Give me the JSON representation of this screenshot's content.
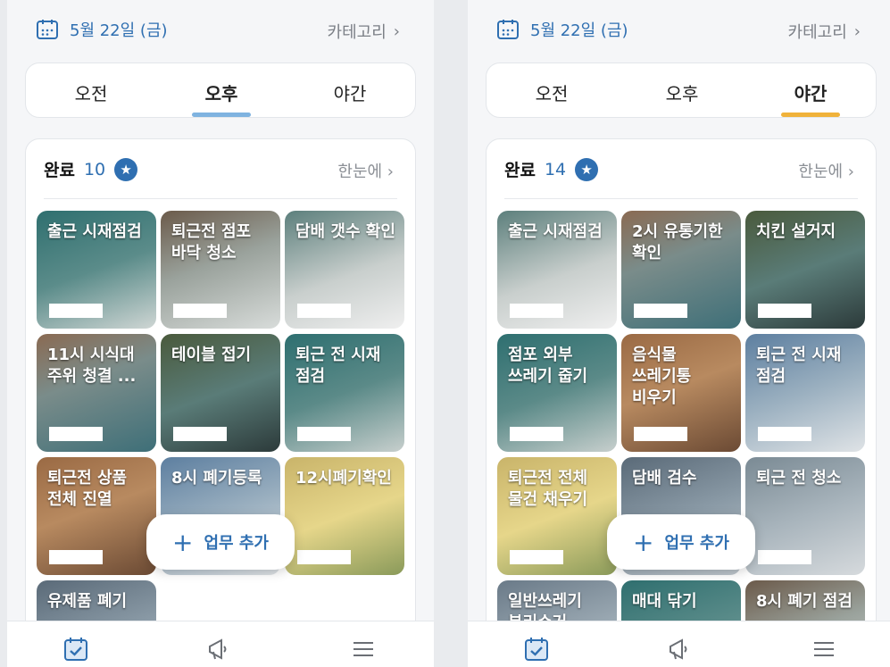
{
  "accent_color": "#2f6fb1",
  "screens": [
    {
      "date": "5월 22일 (금)",
      "category": "카테고리",
      "shifts": [
        "오전",
        "오후",
        "야간"
      ],
      "active_shift": "오후",
      "active_color": "#7fb3e0",
      "done_label": "완료",
      "done_count": "10",
      "glance_label": "한눈에",
      "tasks": [
        "출근 시재점검",
        "퇴근전 점포 바닥 청소",
        "담배 갯수 확인",
        "11시 시식대 주위 청결 ...",
        "테이블 접기",
        "퇴근 전 시재 점검",
        "퇴근전 상품 전체 진열",
        "8시 폐기등록",
        "12시폐기확인",
        "유제품 폐기"
      ],
      "add_button": "업무 추가"
    },
    {
      "date": "5월 22일 (금)",
      "category": "카테고리",
      "shifts": [
        "오전",
        "오후",
        "야간"
      ],
      "active_shift": "야간",
      "active_color": "#f0b23a",
      "done_label": "완료",
      "done_count": "14",
      "glance_label": "한눈에",
      "tasks": [
        "출근 시재점검",
        "2시 유통기한 확인",
        "치킨 설거지",
        "점포 외부 쓰레기 줍기",
        "음식물 쓰레기통 비우기",
        "퇴근 전 시재 점검",
        "퇴근전 전체 물건 채우기",
        "담배 검수",
        "퇴근 전 청소",
        "일반쓰레기 분리수거",
        "매대 닦기",
        "8시 폐기 점검"
      ],
      "add_button": "업무 추가"
    }
  ]
}
